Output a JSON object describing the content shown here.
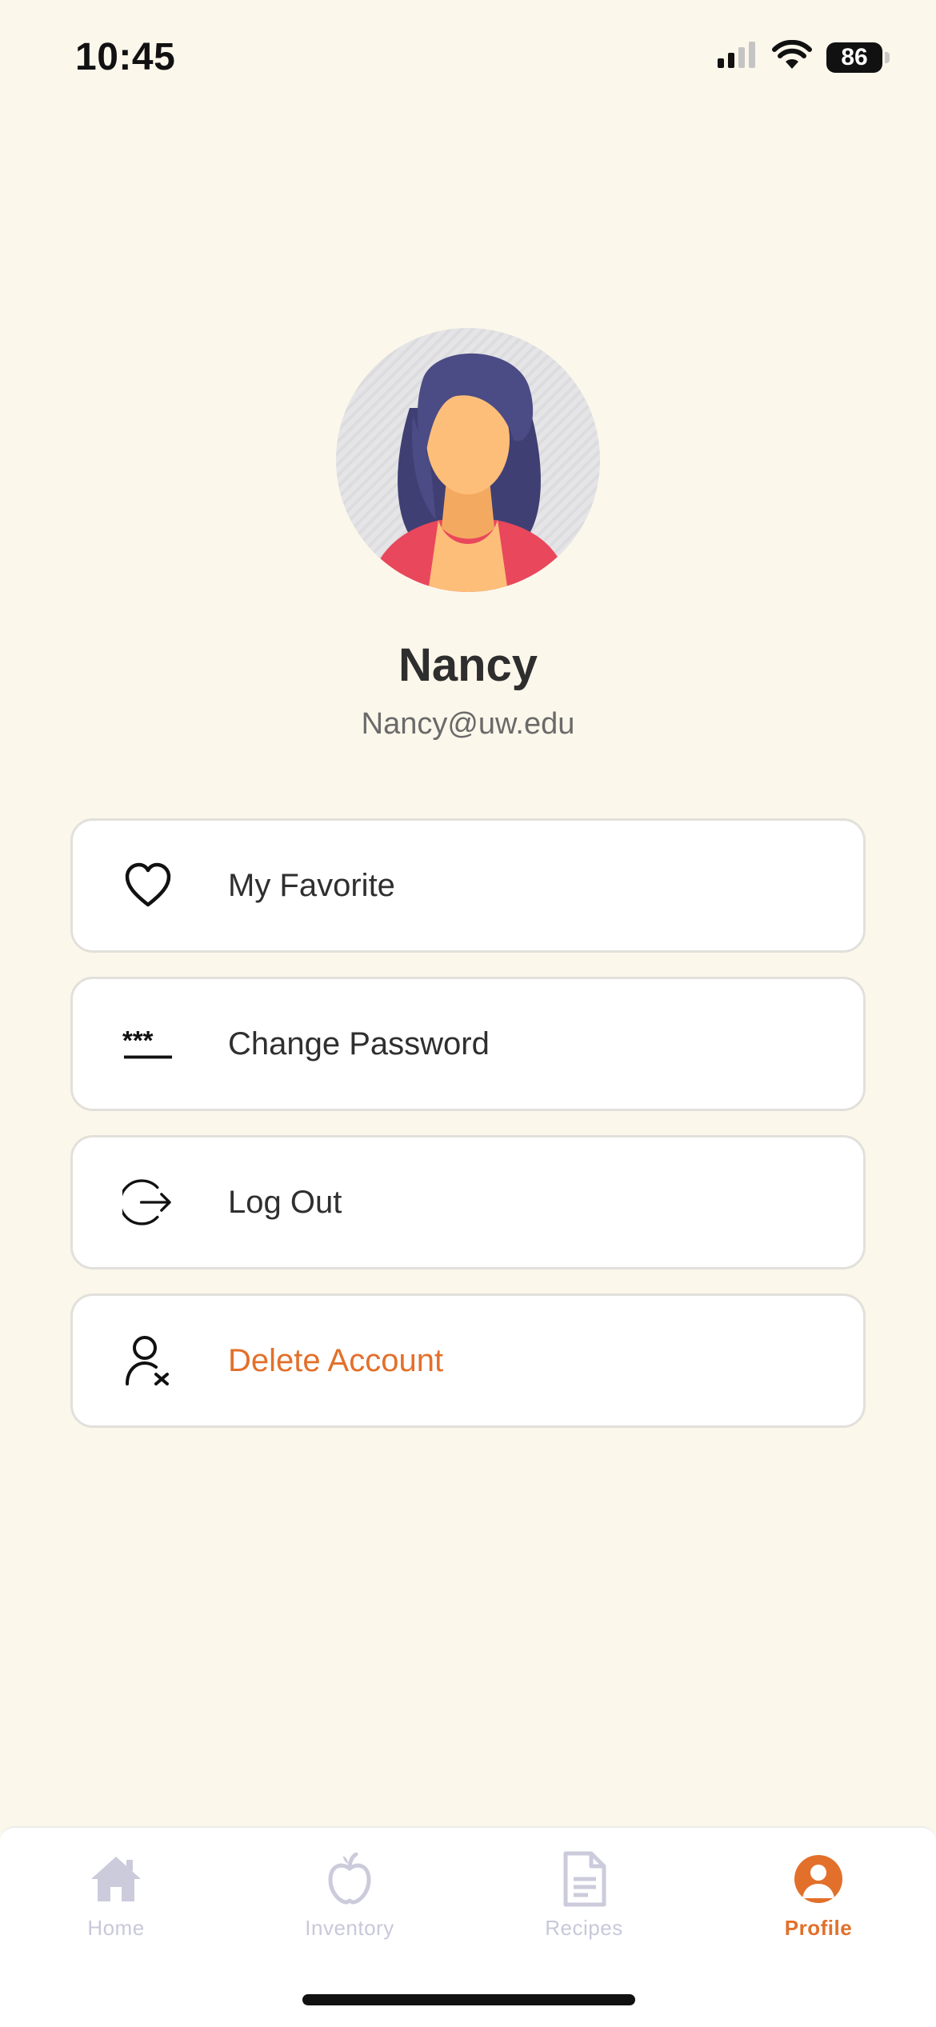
{
  "status_bar": {
    "time": "10:45",
    "battery": "86",
    "icons": [
      "signal-icon",
      "wifi-icon",
      "battery-icon"
    ]
  },
  "profile": {
    "name": "Nancy",
    "email": "Nancy@uw.edu",
    "avatar": "avatar-woman-illustration"
  },
  "menu": {
    "items": [
      {
        "label": "My Favorite",
        "icon": "heart-icon"
      },
      {
        "label": "Change Password",
        "icon": "password-icon"
      },
      {
        "label": "Log Out",
        "icon": "logout-icon"
      },
      {
        "label": "Delete Account",
        "icon": "delete-user-icon",
        "color": "#E2702B"
      }
    ]
  },
  "tab_bar": {
    "tabs": [
      {
        "label": "Home",
        "icon": "home-icon",
        "active": false
      },
      {
        "label": "Inventory",
        "icon": "apple-icon",
        "active": false
      },
      {
        "label": "Recipes",
        "icon": "document-icon",
        "active": false
      },
      {
        "label": "Profile",
        "icon": "profile-icon",
        "active": true
      }
    ],
    "active_color": "#E2702B",
    "inactive_color": "#C8C8DA"
  },
  "colors": {
    "background": "#FCF7EB",
    "accent": "#E2702B"
  }
}
